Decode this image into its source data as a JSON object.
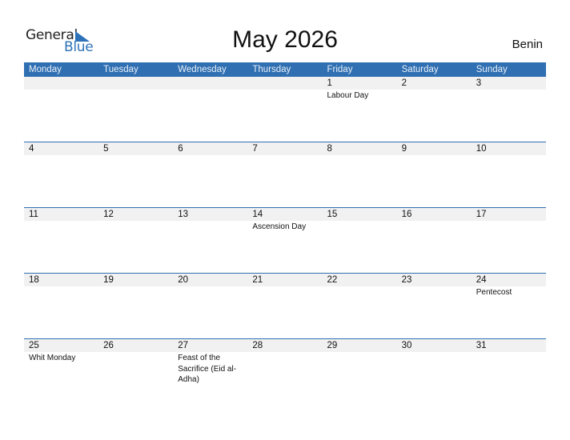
{
  "logo": {
    "line1": "General",
    "line2": "Blue",
    "icon": "triangle-flag-icon"
  },
  "title": "May 2026",
  "country": "Benin",
  "colors": {
    "accent": "#2f6fb2",
    "band": "#f1f1f1"
  },
  "weekdays": [
    "Monday",
    "Tuesday",
    "Wednesday",
    "Thursday",
    "Friday",
    "Saturday",
    "Sunday"
  ],
  "weeks": [
    [
      {
        "day": "",
        "event": ""
      },
      {
        "day": "",
        "event": ""
      },
      {
        "day": "",
        "event": ""
      },
      {
        "day": "",
        "event": ""
      },
      {
        "day": "1",
        "event": "Labour Day"
      },
      {
        "day": "2",
        "event": ""
      },
      {
        "day": "3",
        "event": ""
      }
    ],
    [
      {
        "day": "4",
        "event": ""
      },
      {
        "day": "5",
        "event": ""
      },
      {
        "day": "6",
        "event": ""
      },
      {
        "day": "7",
        "event": ""
      },
      {
        "day": "8",
        "event": ""
      },
      {
        "day": "9",
        "event": ""
      },
      {
        "day": "10",
        "event": ""
      }
    ],
    [
      {
        "day": "11",
        "event": ""
      },
      {
        "day": "12",
        "event": ""
      },
      {
        "day": "13",
        "event": ""
      },
      {
        "day": "14",
        "event": "Ascension Day"
      },
      {
        "day": "15",
        "event": ""
      },
      {
        "day": "16",
        "event": ""
      },
      {
        "day": "17",
        "event": ""
      }
    ],
    [
      {
        "day": "18",
        "event": ""
      },
      {
        "day": "19",
        "event": ""
      },
      {
        "day": "20",
        "event": ""
      },
      {
        "day": "21",
        "event": ""
      },
      {
        "day": "22",
        "event": ""
      },
      {
        "day": "23",
        "event": ""
      },
      {
        "day": "24",
        "event": "Pentecost"
      }
    ],
    [
      {
        "day": "25",
        "event": "Whit Monday"
      },
      {
        "day": "26",
        "event": ""
      },
      {
        "day": "27",
        "event": "Feast of the Sacrifice (Eid al-Adha)"
      },
      {
        "day": "28",
        "event": ""
      },
      {
        "day": "29",
        "event": ""
      },
      {
        "day": "30",
        "event": ""
      },
      {
        "day": "31",
        "event": ""
      }
    ]
  ]
}
